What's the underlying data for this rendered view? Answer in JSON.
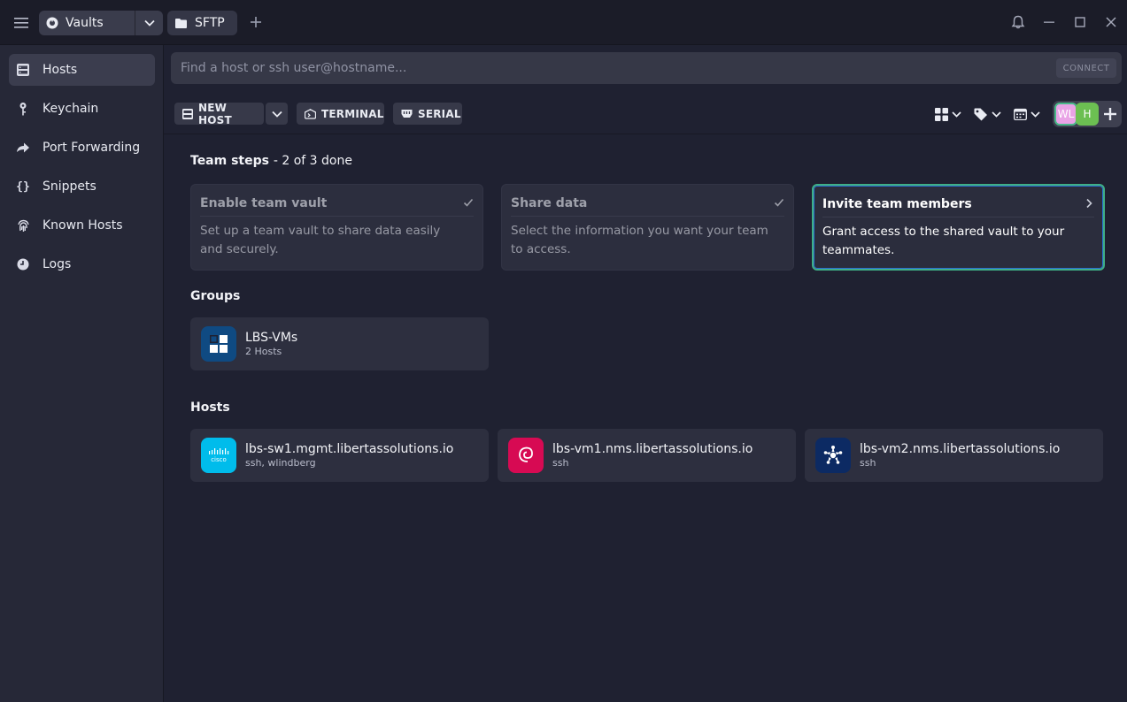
{
  "titlebar": {
    "vault_tab": {
      "label": "Vaults"
    },
    "sftp_tab": {
      "label": "SFTP"
    }
  },
  "sidebar": {
    "items": [
      {
        "label": "Hosts",
        "icon": "hosts-grid-icon",
        "active": true
      },
      {
        "label": "Keychain",
        "icon": "key-icon"
      },
      {
        "label": "Port Forwarding",
        "icon": "forward-arrow-icon"
      },
      {
        "label": "Snippets",
        "icon": "braces-icon"
      },
      {
        "label": "Known Hosts",
        "icon": "fingerprint-icon"
      },
      {
        "label": "Logs",
        "icon": "clock-icon"
      }
    ]
  },
  "search": {
    "placeholder": "Find a host or ssh user@hostname...",
    "connect_label": "CONNECT"
  },
  "toolbar": {
    "new_host_label": "NEW HOST",
    "terminal_label": "TERMINAL",
    "serial_label": "SERIAL",
    "avatars": [
      "WL",
      "H"
    ]
  },
  "team_steps": {
    "title": "Team steps",
    "progress": "- 2 of 3 done",
    "steps": [
      {
        "title": "Enable team vault",
        "description": "Set up a team vault to share data easily and securely.",
        "done": true
      },
      {
        "title": "Share data",
        "description": "Select the information you want your team to access.",
        "done": true
      },
      {
        "title": "Invite team members",
        "description": "Grant access to the shared vault to your teammates.",
        "done": false
      }
    ]
  },
  "groups": {
    "title": "Groups",
    "items": [
      {
        "name": "LBS-VMs",
        "sub": "2 Hosts"
      }
    ]
  },
  "hosts": {
    "title": "Hosts",
    "items": [
      {
        "name": "lbs-sw1.mgmt.libertassolutions.io",
        "sub": "ssh, wlindberg",
        "logo_text": "cisco",
        "logo_color": "#00bceb"
      },
      {
        "name": "lbs-vm1.nms.libertassolutions.io",
        "sub": "ssh",
        "logo_color": "#d70a53"
      },
      {
        "name": "lbs-vm2.nms.libertassolutions.io",
        "sub": "ssh",
        "logo_color": "#0c2a63"
      }
    ]
  },
  "colors": {
    "background": "#1f2131",
    "sidebar": "#262837",
    "accent_green": "#3fae86",
    "accent_blue": "#2a6fcf"
  }
}
